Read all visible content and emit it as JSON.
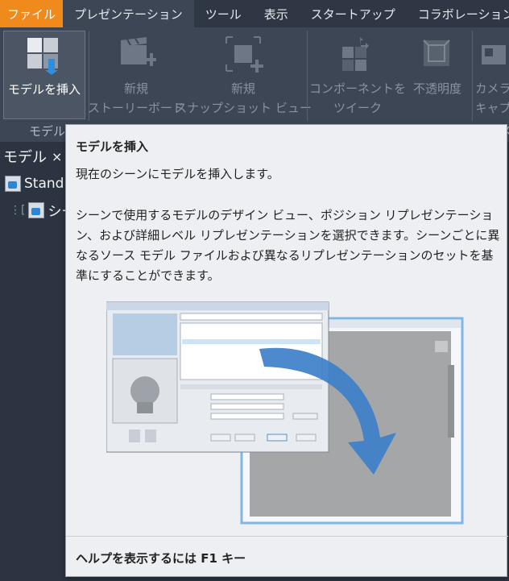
{
  "tabs": [
    {
      "label": "ファイル"
    },
    {
      "label": "プレゼンテーション"
    },
    {
      "label": "ツール"
    },
    {
      "label": "表示"
    },
    {
      "label": "スタートアップ"
    },
    {
      "label": "コラボレーション"
    }
  ],
  "ribbon": {
    "insert_model": {
      "label": "モデルを挿入"
    },
    "new_storyboard": {
      "line1": "新規",
      "line2": "ストーリーボード"
    },
    "new_snapshot": {
      "line1": "新規",
      "line2": "スナップショット ビュー"
    },
    "tweak_components": {
      "line1": "コンポーネントを",
      "line2": "ツイーク"
    },
    "opacity": {
      "label": "不透明度"
    },
    "camera_capture": {
      "line1": "カメラ",
      "line2": "キャプ"
    },
    "panel_model": "モデル",
    "panel_right_fragment": "メ"
  },
  "browser": {
    "title": "モデル",
    "close_glyph": "×",
    "item1": "Stand",
    "item2": "シー"
  },
  "tooltip": {
    "title": "モデルを挿入",
    "subtitle": "現在のシーンにモデルを挿入します。",
    "body": "シーンで使用するモデルのデザイン ビュー、ポジション リプレゼンテーション、および詳細レベル リプレゼンテーションを選択できます。シーンごとに異なるソース モデル ファイルおよび異なるリプレゼンテーションのセットを基準にすることができます。",
    "footer": "ヘルプを表示するには F1 キー"
  },
  "colors": {
    "file_tab": "#f08a1c",
    "ribbon_bg": "#3c4654",
    "tooltip_bg": "#eeeff3",
    "arrow_blue": "#3d7fc9"
  }
}
